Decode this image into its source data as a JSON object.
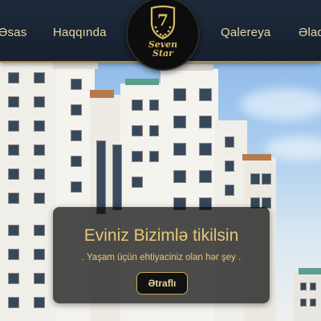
{
  "nav": {
    "items": [
      "Əsas",
      "Haqqında",
      "Qalereya",
      "Əlaqə"
    ]
  },
  "logo": {
    "numeral": "7",
    "line1": "Seven",
    "line2": "Star",
    "icon": "shield-stars-icon"
  },
  "hero": {
    "title": "Eviniz Bizimlə tikilsin",
    "subtitle": ". Yaşam üçün ehtiyaciniz olan hər şey .",
    "button_label": "Ətraflı"
  },
  "colors": {
    "nav_bg": "#1e2a3b",
    "gold": "#e7c777",
    "overlay": "rgba(10,10,10,0.72)"
  }
}
